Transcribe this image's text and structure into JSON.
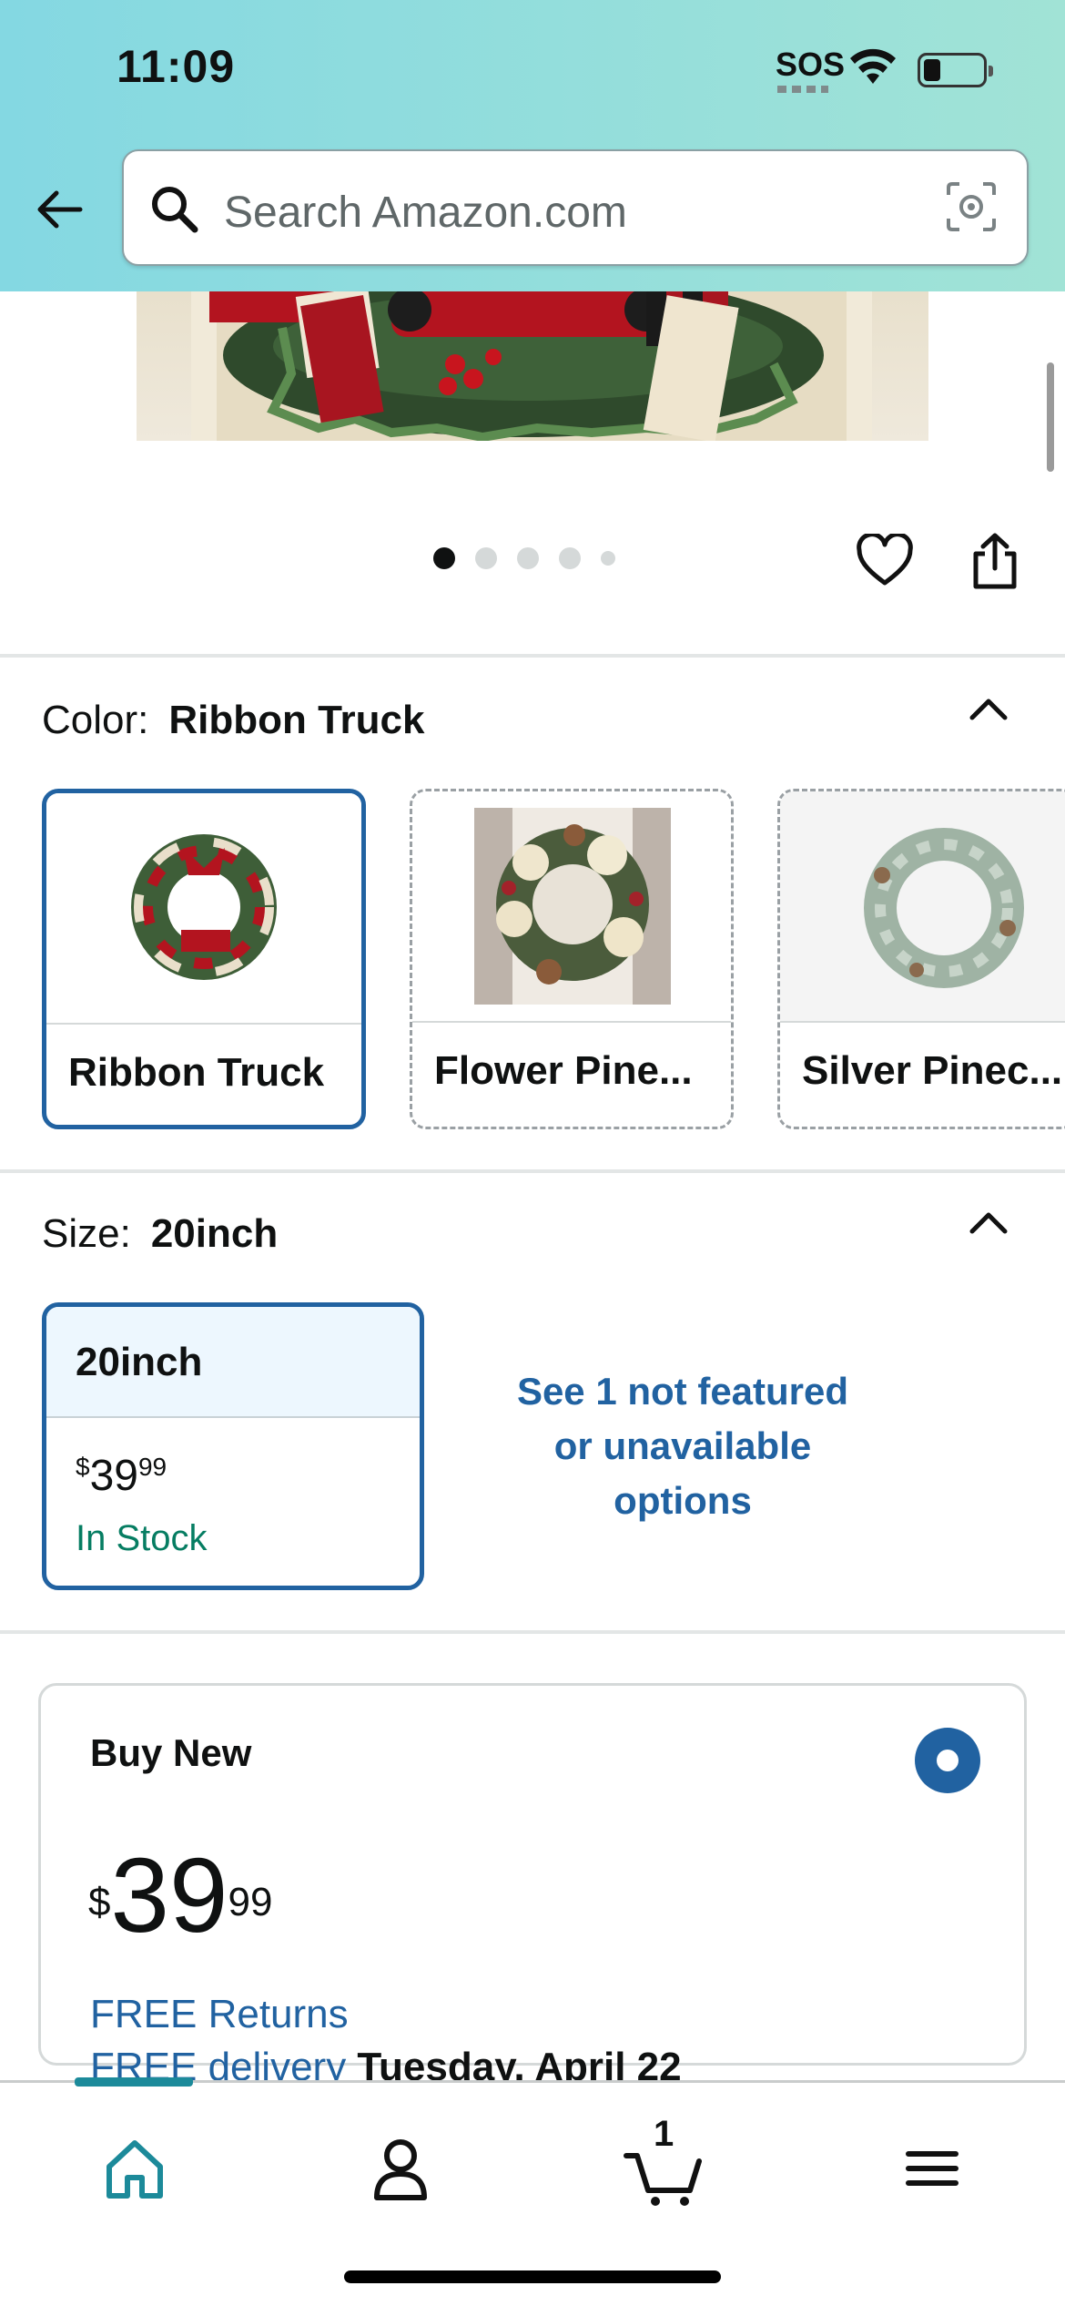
{
  "status_bar": {
    "time": "11:09",
    "sos": "SOS"
  },
  "search": {
    "placeholder": "Search Amazon.com"
  },
  "gallery": {
    "image_count": 5,
    "active_index": 0
  },
  "color_section": {
    "label": "Color:",
    "selected": "Ribbon Truck",
    "options": [
      {
        "label": "Ribbon Truck",
        "selected": true
      },
      {
        "label": "Flower Pine...",
        "selected": false
      },
      {
        "label": "Silver Pinec...",
        "selected": false
      }
    ]
  },
  "size_section": {
    "label": "Size:",
    "selected": "20inch",
    "option": {
      "label": "20inch",
      "price_symbol": "$",
      "price_whole": "39",
      "price_fraction": "99",
      "availability": "In Stock"
    },
    "see_more_line1": "See 1 not featured",
    "see_more_line2": "or unavailable",
    "see_more_line3": "options"
  },
  "buy_box": {
    "title": "Buy New",
    "price_symbol": "$",
    "price_whole": "39",
    "price_fraction": "99",
    "free_returns": "FREE Returns",
    "delivery_link": "FREE delivery",
    "delivery_date": "Tuesday, April 22"
  },
  "bottom_nav": {
    "cart_count": "1"
  },
  "colors": {
    "accent": "#2162a1",
    "in_stock": "#067d62",
    "header_start": "#84d8e2",
    "header_end": "#a1e3d6"
  }
}
